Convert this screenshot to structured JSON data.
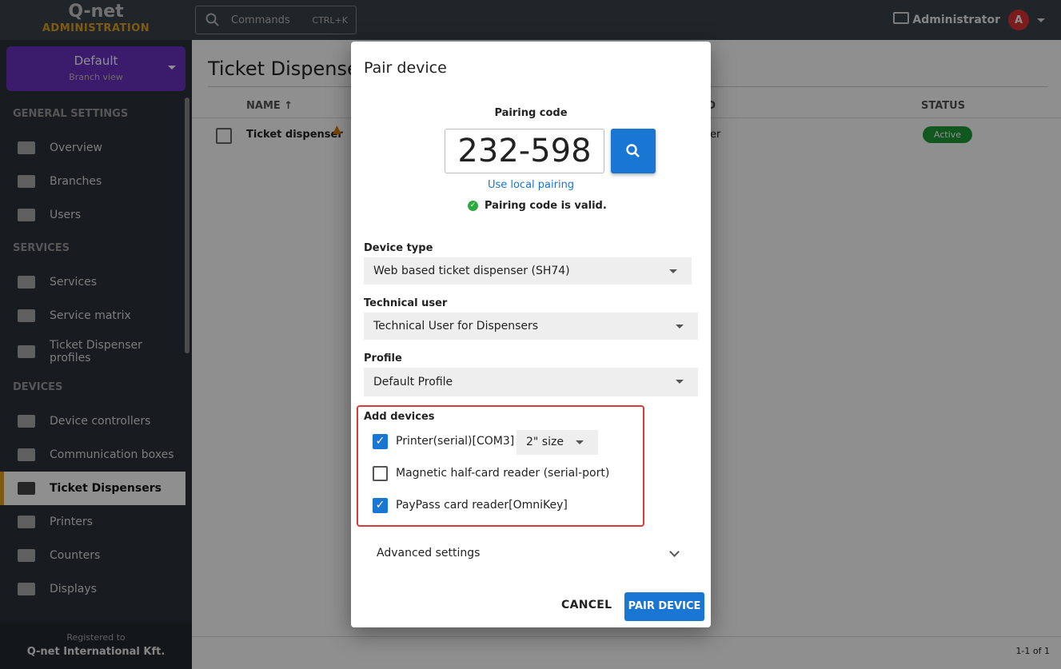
{
  "header": {
    "logo_top": "Q-net",
    "logo_bottom": "ADMINISTRATION",
    "commands_placeholder": "Commands",
    "commands_shortcut": "CTRL+K",
    "user": "Administrator",
    "avatar_letter": "A"
  },
  "sidebar": {
    "branch": {
      "name": "Default",
      "sub": "Branch view"
    },
    "sections": [
      {
        "title": "GENERAL SETTINGS",
        "items": [
          "Overview",
          "Branches",
          "Users"
        ]
      },
      {
        "title": "SERVICES",
        "items": [
          "Services",
          "Service matrix",
          "Ticket Dispenser profiles"
        ]
      },
      {
        "title": "DEVICES",
        "items": [
          "Device controllers",
          "Communication boxes",
          "Ticket Dispensers",
          "Printers",
          "Counters",
          "Displays"
        ]
      }
    ],
    "active": "Ticket Dispensers",
    "footer": {
      "line1": "Registered to",
      "line2": "Q-net International Kft."
    }
  },
  "main": {
    "title": "Ticket Dispenser",
    "columns": {
      "name": "NAME ↑",
      "id": "T ID",
      "status": "STATUS"
    },
    "row": {
      "name": "Ticket dispenser",
      "mid": "er",
      "status": "Active"
    },
    "pagination": "1-1 of 1"
  },
  "dialog": {
    "title": "Pair device",
    "pairing_label": "Pairing code",
    "pairing_code": "232-598",
    "local_pairing": "Use local pairing",
    "valid_msg": "Pairing code is valid.",
    "device_type_label": "Device type",
    "device_type": "Web based ticket dispenser (SH74)",
    "tech_user_label": "Technical user",
    "tech_user": "Technical User for Dispensers",
    "profile_label": "Profile",
    "profile": "Default Profile",
    "add_devices_label": "Add devices",
    "devices": [
      {
        "label": "Printer(serial)[COM3]",
        "checked": true,
        "size": "2\" size"
      },
      {
        "label": "Magnetic half-card reader (serial-port)",
        "checked": false
      },
      {
        "label": "PayPass card reader[OmniKey]",
        "checked": true
      }
    ],
    "advanced": "Advanced settings",
    "cancel": "CANCEL",
    "pair": "PAIR DEVICE"
  },
  "colors": {
    "accent": "#1976d2",
    "branch": "#6a33c0",
    "highlight": "#d93a3a",
    "active_badge": "#1f9d3a"
  }
}
